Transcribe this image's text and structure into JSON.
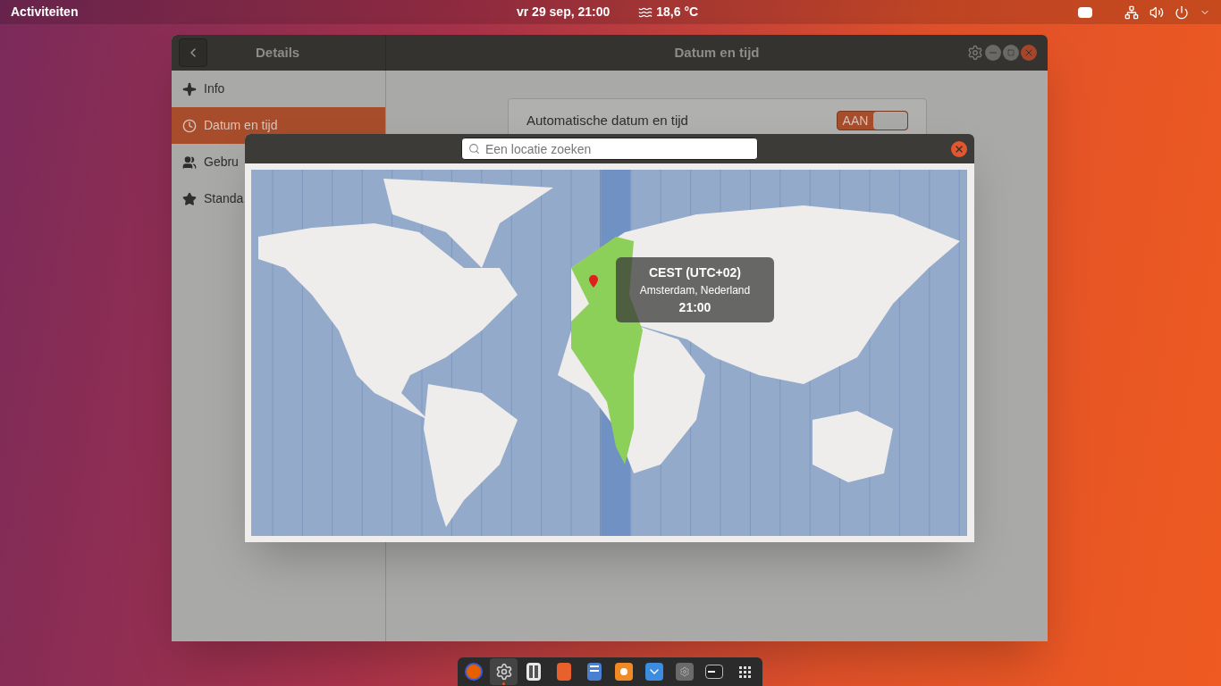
{
  "top_bar": {
    "activities": "Activiteiten",
    "clock": "vr 29 sep, 21:00",
    "weather": "18,6 °C"
  },
  "settings_window": {
    "sidebar_title": "Details",
    "title": "Datum en tijd",
    "sidebar": [
      {
        "label": "Info",
        "kind": "sparkle",
        "selected": false
      },
      {
        "label": "Datum en tijd",
        "kind": "clock",
        "selected": true
      },
      {
        "label": "Gebru",
        "kind": "users",
        "selected": false
      },
      {
        "label": "Standa",
        "kind": "star",
        "selected": false
      }
    ],
    "setting": {
      "label": "Automatische datum en tijd",
      "toggle": {
        "label": "AAN",
        "on": true
      }
    }
  },
  "location_dialog": {
    "search": {
      "placeholder": "Een locatie zoeken"
    },
    "tooltip": {
      "zone": "CEST (UTC+02)",
      "location": "Amsterdam, Nederland",
      "time": "21:00"
    }
  },
  "dock": [
    {
      "kind": "browser",
      "selected": false
    },
    {
      "kind": "settings",
      "selected": true
    },
    {
      "kind": "switches",
      "selected": false
    },
    {
      "kind": "store",
      "selected": false
    },
    {
      "kind": "files",
      "selected": false
    },
    {
      "kind": "orange",
      "selected": false
    },
    {
      "kind": "download",
      "selected": false
    },
    {
      "kind": "grey-gear",
      "selected": false
    },
    {
      "kind": "terminal",
      "selected": false
    },
    {
      "kind": "grid",
      "selected": false
    }
  ]
}
